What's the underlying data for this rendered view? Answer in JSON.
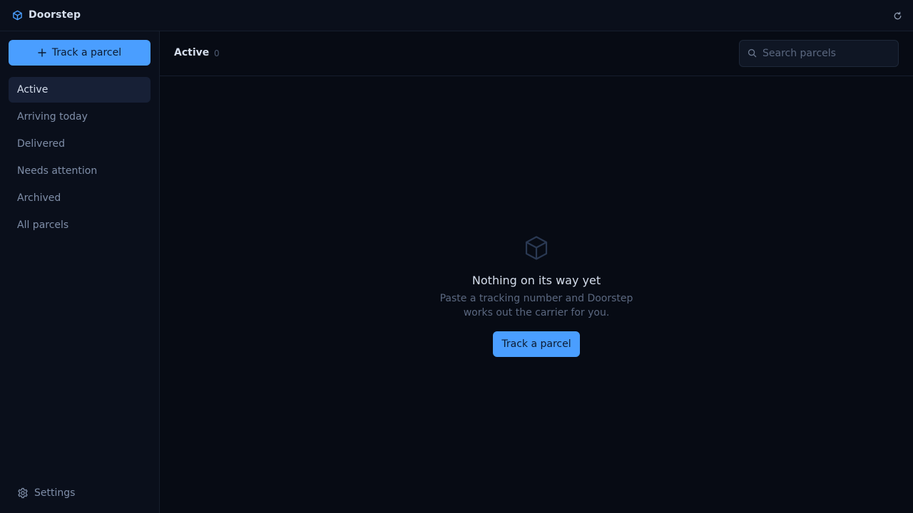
{
  "app": {
    "title": "Doorstep",
    "logo_icon": "box-icon",
    "refresh_icon": "refresh-icon"
  },
  "sidebar": {
    "track_button_label": "Track a parcel",
    "items": [
      {
        "label": "Active",
        "active": true
      },
      {
        "label": "Arriving today",
        "active": false
      },
      {
        "label": "Delivered",
        "active": false
      },
      {
        "label": "Needs attention",
        "active": false
      },
      {
        "label": "Archived",
        "active": false
      },
      {
        "label": "All parcels",
        "active": false
      }
    ],
    "settings_label": "Settings"
  },
  "header": {
    "title": "Active",
    "count": "0",
    "search_placeholder": "Search parcels",
    "search_value": ""
  },
  "empty_state": {
    "title": "Nothing on its way yet",
    "description": "Paste a tracking number and Doorstep works out the carrier for you.",
    "button_label": "Track a parcel"
  },
  "colors": {
    "accent": "#4a9eff",
    "background": "#070b14",
    "sidebar": "#0a0f1b",
    "active_item": "#172036"
  }
}
